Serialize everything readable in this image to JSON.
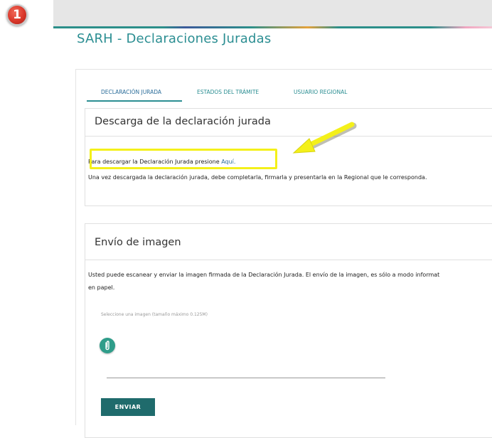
{
  "step_badge": "1",
  "page_title": "SARH - Declaraciones Juradas",
  "tabs": [
    {
      "label": "DECLARACIÓN JURADA"
    },
    {
      "label": "ESTADOS DEL TRÁMITE"
    },
    {
      "label": "USUARIO REGIONAL"
    }
  ],
  "download_panel": {
    "title": "Descarga de la declaración jurada",
    "line1_prefix": "Para descargar la Declaración Jurada presione ",
    "line1_link": "Aquí.",
    "line2": "Una vez descargada la declaración jurada, debe completarla, firmarla y presentarla en la Regional que le corresponda."
  },
  "upload_panel": {
    "title": "Envío de imagen",
    "description_line1": "Usted puede escanear y enviar la imagen firmada de la Declaración Jurada. El envío de la imagen, es sólo a modo informat",
    "description_line2": "en papel.",
    "file_hint": "Seleccione una imagen (tamaño máximo 0.125M)",
    "send_label": "ENVIAR"
  },
  "colors": {
    "accent": "#2b8e92",
    "highlight": "#f4f01a",
    "send_button": "#1f6b6c",
    "attach_button": "#2f9d8a",
    "step_badge": "#d9372a"
  },
  "icons": {
    "attach": "paperclip-icon",
    "annotation": "yellow-arrow-annotation"
  }
}
